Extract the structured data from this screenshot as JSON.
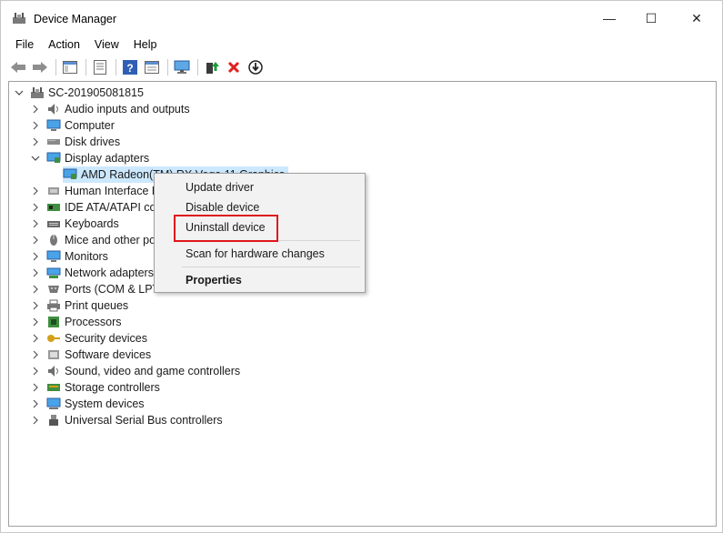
{
  "window": {
    "title": "Device Manager",
    "controls": {
      "minimize": "—",
      "maximize": "☐",
      "close": "✕"
    }
  },
  "menu": [
    "File",
    "Action",
    "View",
    "Help"
  ],
  "toolbar": {
    "icons": [
      "back-icon",
      "forward-icon",
      "show-hide-tree-icon",
      "properties-icon",
      "help-icon",
      "view-icon",
      "monitor-scan-icon",
      "update-driver-icon",
      "uninstall-icon",
      "download-icon"
    ]
  },
  "tree": {
    "root": "SC-201905081815",
    "categories": [
      "Audio inputs and outputs",
      "Computer",
      "Disk drives",
      "Display adapters",
      "Human Interface D",
      "IDE ATA/ATAPI cor",
      "Keyboards",
      "Mice and other po",
      "Monitors",
      "Network adapters",
      "Ports (COM & LPT",
      "Print queues",
      "Processors",
      "Security devices",
      "Software devices",
      "Sound, video and game controllers",
      "Storage controllers",
      "System devices",
      "Universal Serial Bus controllers"
    ],
    "expanded_child": "AMD Radeon(TM) RX Vega 11 Graphics"
  },
  "context_menu": {
    "items": [
      "Update driver",
      "Disable device",
      "Uninstall device",
      "Scan for hardware changes",
      "Properties"
    ]
  },
  "colors": {
    "selection": "#cce8ff",
    "highlight_box": "#e0161b",
    "uninstall_red": "#e02020",
    "update_green": "#1f9a3a"
  }
}
